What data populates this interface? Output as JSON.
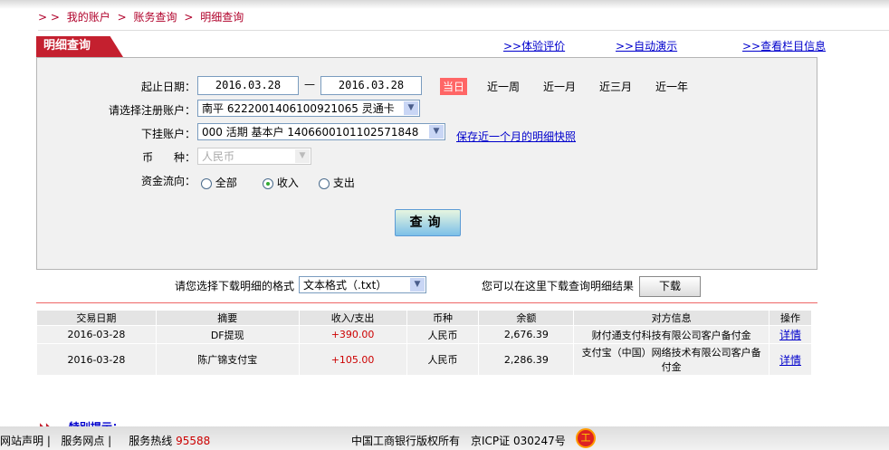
{
  "breadcrumb": {
    "prefix": "> >",
    "items": [
      "我的账户",
      "账务查询",
      "明细查询"
    ],
    "sep": ">"
  },
  "tab_title": "明细查询",
  "top_links": [
    ">>体验评价",
    ">>自动演示",
    ">>查看栏目信息"
  ],
  "form": {
    "date_label": "起止日期：",
    "start_date": "2016.03.28",
    "dash": "—",
    "end_date": "2016.03.28",
    "quick": [
      "当日",
      "近一周",
      "近一月",
      "近三月",
      "近一年"
    ],
    "account_label": "请选择注册账户：",
    "account_value": "南平  6222001406100921065  灵通卡",
    "sub_label": "下挂账户：",
    "sub_value": "000  活期  基本户  1406600101102571848",
    "snapshot_link": "保存近一个月的明细快照",
    "currency_label": "币      种：",
    "currency_value": "人民币",
    "flow_label": "资金流向：",
    "flow_options": [
      "全部",
      "收入",
      "支出"
    ],
    "flow_selected": "收入",
    "query_button": "查询"
  },
  "download": {
    "format_label": "请您选择下载明细的格式",
    "format_value": "文本格式（.txt）",
    "hint": "您可以在这里下载查询明细结果",
    "button": "下载"
  },
  "table": {
    "headers": [
      "交易日期",
      "摘要",
      "收入/支出",
      "币种",
      "余额",
      "对方信息",
      "操作"
    ],
    "rows": [
      [
        "2016-03-28",
        "DF提现",
        "+390.00",
        "人民币",
        "2,676.39",
        "财付通支付科技有限公司客户备付金",
        "详情"
      ],
      [
        "2016-03-28",
        "陈广锦支付宝",
        "+105.00",
        "人民币",
        "2,286.39",
        "支付宝（中国）网络技术有限公司客户备付金",
        "详情"
      ]
    ]
  },
  "tip": "特别提示：",
  "footer": {
    "left": [
      "网站声明",
      "服务网点"
    ],
    "hotline_label": "服务热线",
    "hotline": "95588",
    "copyright": "中国工商银行版权所有",
    "icp": "京ICP证 030247号"
  },
  "colors": {
    "brand": "#c4202f",
    "link": "#0000cc",
    "amount": "#cc0000"
  }
}
